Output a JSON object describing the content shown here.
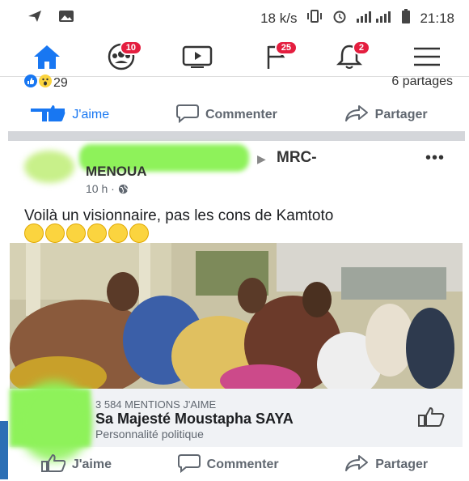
{
  "status_bar": {
    "speed": "18 k/s",
    "time": "21:18"
  },
  "nav": {
    "friends_badge": "10",
    "groups_badge": "25",
    "notifications_badge": "2"
  },
  "prev_post": {
    "reaction_count": "29",
    "shares": "6 partages"
  },
  "actions": {
    "like": "J'aime",
    "comment": "Commenter",
    "share": "Partager"
  },
  "post": {
    "group_part1": "MRC-",
    "group_part2": "MENOUA",
    "time": "10 h ·",
    "text": "Voilà un visionnaire, pas les cons de Kamtoto"
  },
  "page_card": {
    "mentions": "3 584 MENTIONS J'AIME",
    "title": "Sa Majesté Moustapha SAYA",
    "category": "Personnalité politique"
  },
  "colors": {
    "accent": "#1877f2",
    "badge": "#e41e3f",
    "blur_green": "#8ef25a"
  }
}
